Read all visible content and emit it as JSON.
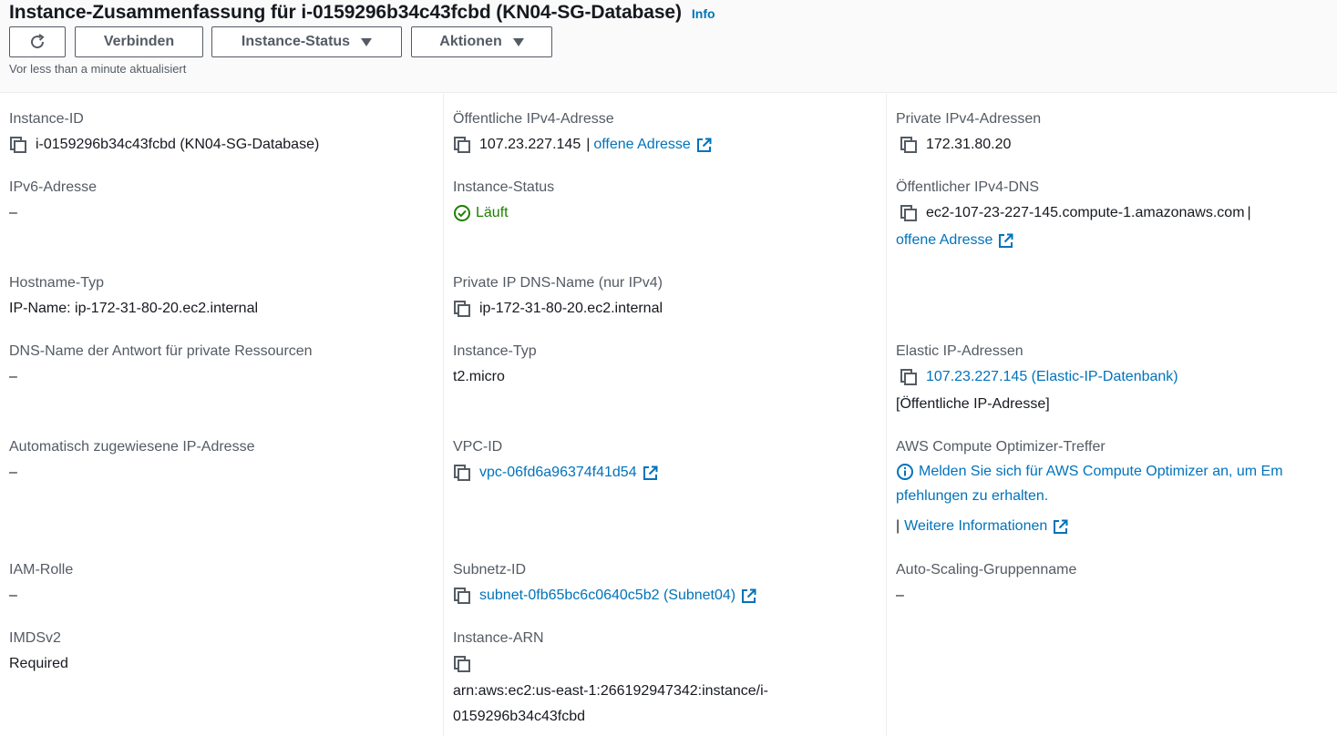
{
  "header": {
    "title": "Instance-Zusammenfassung für i-0159296b34c43fcbd (KN04-SG-Database)",
    "info": "Info",
    "refresh_icon": "refresh-icon",
    "connect_label": "Verbinden",
    "instance_state_label": "Instance-Status",
    "actions_label": "Aktionen",
    "updated": "Vor less than a minute aktualisiert"
  },
  "fields": {
    "instance_id": {
      "label": "Instance-ID",
      "value": "i-0159296b34c43fcbd (KN04-SG-Database)"
    },
    "ipv6": {
      "label": "IPv6-Adresse",
      "value": "–"
    },
    "hostname_type": {
      "label": "Hostname-Typ",
      "value": "IP-Name: ip-172-31-80-20.ec2.internal"
    },
    "dns_private_resources": {
      "label": "DNS-Name der Antwort für private Ressourcen",
      "value": "–"
    },
    "auto_ip": {
      "label": "Automatisch zugewiesene IP-Adresse",
      "value": "–"
    },
    "iam_role": {
      "label": "IAM-Rolle",
      "value": "–"
    },
    "imdsv2": {
      "label": "IMDSv2",
      "value": "Required"
    },
    "public_ipv4": {
      "label": "Öffentliche IPv4-Adresse",
      "value": "107.23.227.145",
      "separator": "|",
      "link": "offene Adresse"
    },
    "instance_state": {
      "label": "Instance-Status",
      "value": "Läuft"
    },
    "private_dns_name": {
      "label": "Private IP DNS-Name (nur IPv4)",
      "value": "ip-172-31-80-20.ec2.internal"
    },
    "instance_type": {
      "label": "Instance-Typ",
      "value": "t2.micro"
    },
    "vpc_id": {
      "label": "VPC-ID",
      "value": "vpc-06fd6a96374f41d54"
    },
    "subnet_id": {
      "label": "Subnetz-ID",
      "value": "subnet-0fb65bc6c0640c5b2 (Subnet04)"
    },
    "instance_arn": {
      "label": "Instance-ARN",
      "value_line1": "arn:aws:ec2:us-east-1:266192947342:instance/i-",
      "value_line2": "0159296b34c43fcbd"
    },
    "private_ipv4": {
      "label": "Private IPv4-Adressen",
      "value": "172.31.80.20"
    },
    "public_dns": {
      "label": "Öffentlicher IPv4-DNS",
      "value": "ec2-107-23-227-145.compute-1.amazonaws.com",
      "separator": "|",
      "link": "offene Adresse"
    },
    "elastic_ip": {
      "label": "Elastic IP-Adressen",
      "value": "107.23.227.145 (Elastic-IP-Datenbank)",
      "note": "[Öffentliche IP-Adresse]"
    },
    "optimizer": {
      "label": "AWS Compute Optimizer-Treffer",
      "value_line1": "Melden Sie sich für AWS Compute Optimizer an, um Em",
      "value_line2": "pfehlungen zu erhalten.",
      "separator": "|",
      "link": "Weitere Informationen"
    },
    "asg_name": {
      "label": "Auto-Scaling-Gruppenname",
      "value": "–"
    }
  },
  "colors": {
    "link": "#0073bb",
    "running": "#1d8102",
    "label": "#545b64"
  }
}
